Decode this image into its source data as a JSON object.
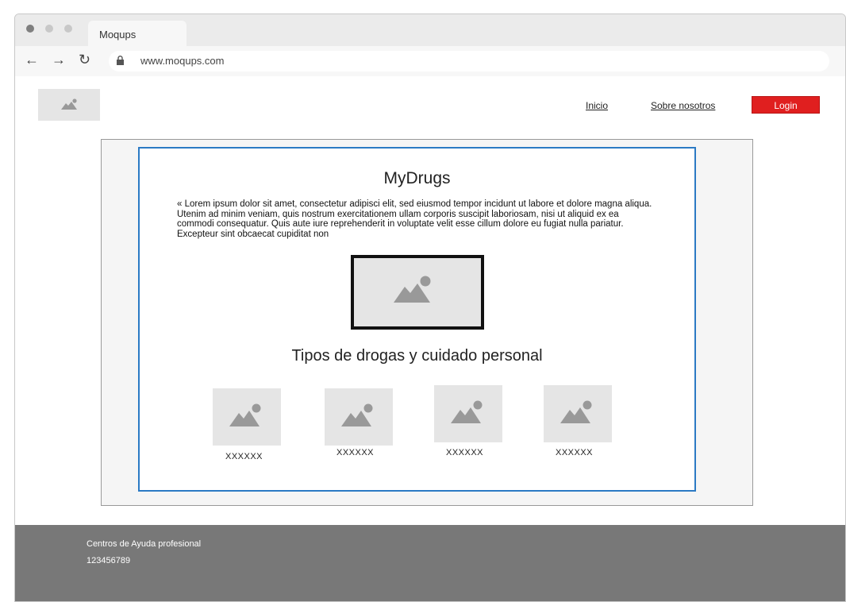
{
  "browser": {
    "tab_title": "Moqups",
    "url": "www.moqups.com",
    "dot_colors": [
      "#7f7f7f",
      "#c8c8c8",
      "#c8c8c8"
    ],
    "icons": {
      "back": "back-arrow-icon",
      "forward": "forward-arrow-icon",
      "reload": "reload-icon",
      "lock": "lock-icon"
    }
  },
  "header": {
    "logo_icon": "image-placeholder-icon",
    "nav": {
      "home": "Inicio",
      "about": "Sobre nosotros",
      "login": "Login"
    },
    "login_color": "#e01f1f"
  },
  "main": {
    "title": "MyDrugs",
    "intro": "« Lorem ipsum dolor sit amet, consectetur adipisci elit, sed eiusmod tempor incidunt ut labore et dolore magna aliqua. Utenim ad minim veniam, quis nostrum exercitationem ullam corporis suscipit laboriosam, nisi ut aliquid ex ea commodi consequatur. Quis aute iure reprehenderit in voluptate velit esse cillum dolore eu fugiat nulla pariatur. Excepteur sint obcaecat cupiditat non",
    "subtitle": "Tipos de drogas y cuidado personal",
    "thumbs": [
      {
        "label": "XXXXXX"
      },
      {
        "label": "XXXXXX"
      },
      {
        "label": "XXXXXX"
      },
      {
        "label": "XXXXXX"
      }
    ],
    "card_border_color": "#2b7ac4"
  },
  "footer": {
    "line1": "Centros de Ayuda profesional",
    "line2": "123456789"
  }
}
